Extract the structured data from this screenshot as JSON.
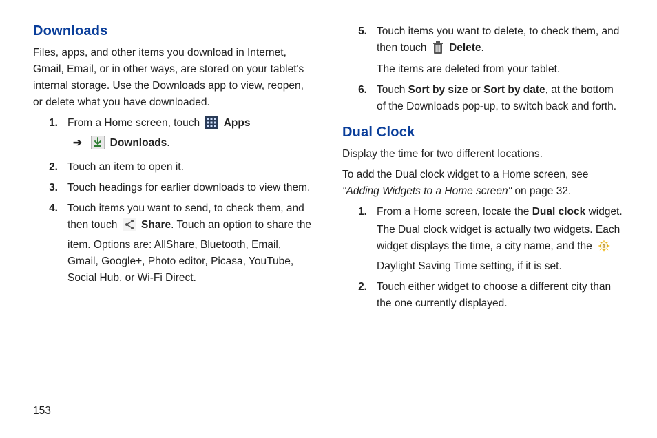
{
  "left": {
    "heading": "Downloads",
    "intro": "Files, apps, and other items you download in Internet, Gmail, Email, or in other ways, are stored on your tablet's internal storage. Use the Downloads app to view, reopen, or delete what you have downloaded.",
    "step1_a": "From a Home screen, touch ",
    "step1_apps": "Apps",
    "step1_arrow": "➔",
    "step1_downloads": "Downloads",
    "step2": "Touch an item to open it.",
    "step3": "Touch headings for earlier downloads to view them.",
    "step4_a": "Touch items you want to send, to check them, and then touch ",
    "step4_share": "Share",
    "step4_b": ". Touch an option to share the item. Options are: AllShare, Bluetooth, Email, Gmail, Google+, Photo editor, Picasa, YouTube, Social Hub, or Wi-Fi Direct."
  },
  "right": {
    "step5_a": "Touch items you want to delete, to check them, and then touch ",
    "step5_delete": "Delete",
    "step5_b": "The items are deleted from your tablet.",
    "step6_a": "Touch ",
    "step6_bold1": "Sort by size",
    "step6_or": " or ",
    "step6_bold2": "Sort by date",
    "step6_b": ", at the bottom of the Downloads pop-up, to switch back and forth.",
    "heading": "Dual Clock",
    "intro1": "Display the time for two different locations.",
    "intro2_a": "To add the Dual clock widget to a Home screen, see ",
    "intro2_ref": "\"Adding Widgets to a Home screen\"",
    "intro2_b": " on page 32.",
    "dc1_a": "From a Home screen, locate the ",
    "dc1_bold": "Dual clock",
    "dc1_b": " widget.",
    "dc1_c": "The Dual clock widget is actually two widgets. Each widget displays the time, a city name, and the ",
    "dc1_d": " Daylight Saving Time setting, if it is set.",
    "dc2": "Touch either widget to choose a different city than the one currently displayed."
  },
  "nums": {
    "n1": "1.",
    "n2": "2.",
    "n3": "3.",
    "n4": "4.",
    "n5": "5.",
    "n6": "6."
  },
  "page_number": "153"
}
